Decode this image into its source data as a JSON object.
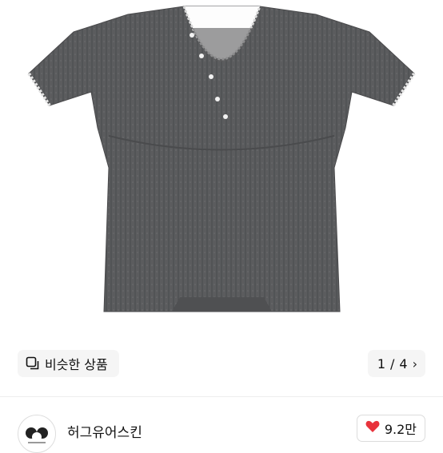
{
  "product": {
    "similar_label": "비슷한 상품",
    "page_current": "1",
    "page_total": "4",
    "page_separator": " / "
  },
  "seller": {
    "name": "허그유어스킨",
    "likes": "9.2만"
  },
  "colors": {
    "shirt": "#5a5b5d",
    "heart": "#e8333c"
  },
  "icons": {
    "similar": "similar-items-icon",
    "chevron": "chevron-right-icon",
    "heart": "heart-icon"
  }
}
